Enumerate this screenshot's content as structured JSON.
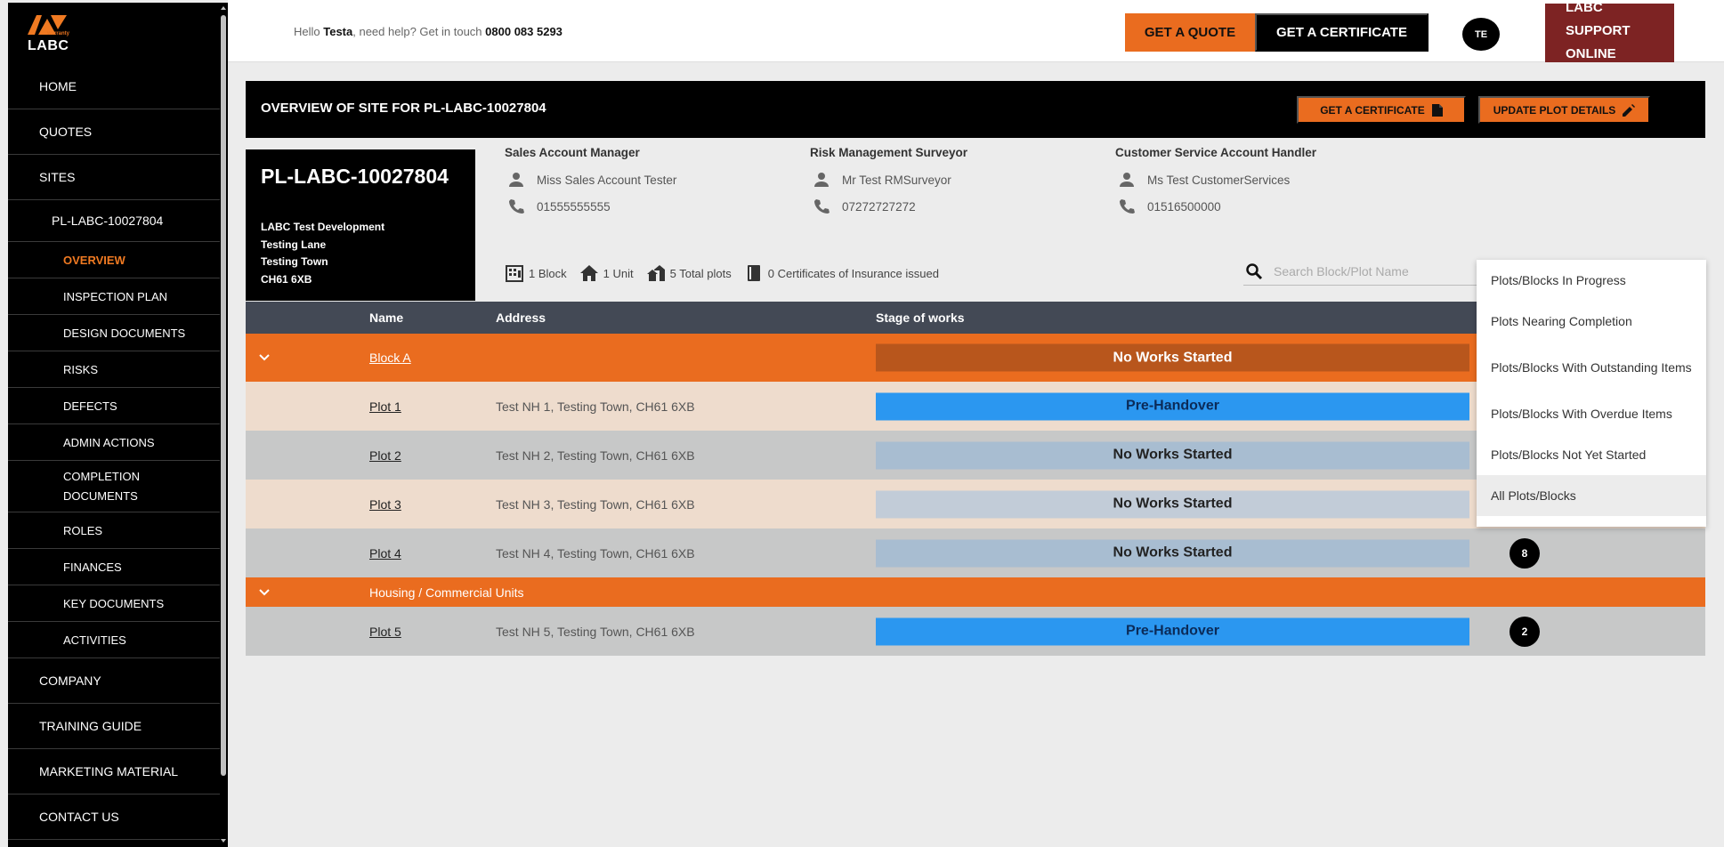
{
  "brand": {
    "logo_text": "LABC",
    "logo_sub": "warranty"
  },
  "sidebar": {
    "items": [
      {
        "label": "HOME"
      },
      {
        "label": "QUOTES"
      },
      {
        "label": "SITES"
      }
    ],
    "site_ref": "PL-LABC-10027804",
    "sub_items": [
      {
        "label": "OVERVIEW"
      },
      {
        "label": "INSPECTION PLAN"
      },
      {
        "label": "DESIGN DOCUMENTS"
      },
      {
        "label": "RISKS"
      },
      {
        "label": "DEFECTS"
      },
      {
        "label": "ADMIN ACTIONS"
      },
      {
        "label_line1": "COMPLETION",
        "label_line2": "DOCUMENTS"
      },
      {
        "label": "ROLES"
      },
      {
        "label": "FINANCES"
      },
      {
        "label": "KEY DOCUMENTS"
      },
      {
        "label": "ACTIVITIES"
      }
    ],
    "bottom_items": [
      {
        "label": "COMPANY"
      },
      {
        "label": "TRAINING GUIDE"
      },
      {
        "label": "MARKETING MATERIAL"
      },
      {
        "label": "CONTACT US"
      }
    ]
  },
  "header": {
    "hello_prefix": "Hello",
    "user_name": "Testa",
    "help_text": ", need help? Get in touch",
    "phone": "0800 083 5293",
    "quote_label": "GET A QUOTE",
    "certificate_label": "GET A CERTIFICATE",
    "avatar_initials": "TE",
    "support_line1": "LABC",
    "support_line2": "SUPPORT",
    "support_line3": "ONLINE",
    "colors": {
      "orange": "#ea6c1f",
      "support": "#7d2323"
    }
  },
  "site_bar": {
    "title": "OVERVIEW OF SITE FOR PL-LABC-10027804",
    "cert_label": "GET A CERTIFICATE",
    "update_label": "UPDATE PLOT DETAILS"
  },
  "site_card": {
    "ref": "PL-LABC-10027804",
    "addr1": "LABC Test Development",
    "addr2": "Testing Lane",
    "addr3": "Testing Town",
    "addr4": "CH61 6XB"
  },
  "contacts": [
    {
      "role": "Sales Account Manager",
      "name": "Miss Sales Account Tester",
      "phone": "01555555555"
    },
    {
      "role": "Risk Management Surveyor",
      "name": "Mr Test RMSurveyor",
      "phone": "07272727272"
    },
    {
      "role": "Customer Service Account Handler",
      "name": "Ms Test CustomerServices",
      "phone": "01516500000"
    }
  ],
  "stats": {
    "blocks": "1 Block",
    "units": "1 Unit",
    "plots": "5 Total plots",
    "certs": "0 Certificates of Insurance issued"
  },
  "search": {
    "placeholder": "Search Block/Plot Name"
  },
  "table": {
    "headers": {
      "name": "Name",
      "address": "Address",
      "stage": "Stage of works"
    },
    "block_a": {
      "name": "Block A",
      "stage": "No Works Started"
    },
    "plots_a": [
      {
        "name": "Plot 1",
        "address": "Test NH 1, Testing Town, CH61 6XB",
        "stage": "Pre-Handover"
      },
      {
        "name": "Plot 2",
        "address": "Test NH 2, Testing Town, CH61 6XB",
        "stage": "No Works Started"
      },
      {
        "name": "Plot 3",
        "address": "Test NH 3, Testing Town, CH61 6XB",
        "stage": "No Works Started"
      },
      {
        "name": "Plot 4",
        "address": "Test NH 4, Testing Town, CH61 6XB",
        "stage": "No Works Started",
        "count": "8"
      }
    ],
    "block_b": {
      "name": "Housing / Commercial Units"
    },
    "plots_b": [
      {
        "name": "Plot 5",
        "address": "Test NH 5, Testing Town, CH61 6XB",
        "stage": "Pre-Handover",
        "count": "2"
      }
    ]
  },
  "filter_dropdown": {
    "options": [
      {
        "label": "Plots/Blocks In Progress"
      },
      {
        "label": "Plots Nearing Completion"
      },
      {
        "label": "Plots/Blocks With Outstanding Items"
      },
      {
        "label": "Plots/Blocks With Overdue Items"
      },
      {
        "label": "Plots/Blocks Not Yet Started"
      },
      {
        "label": "All Plots/Blocks"
      }
    ],
    "selected": "All Plots/Blocks"
  }
}
